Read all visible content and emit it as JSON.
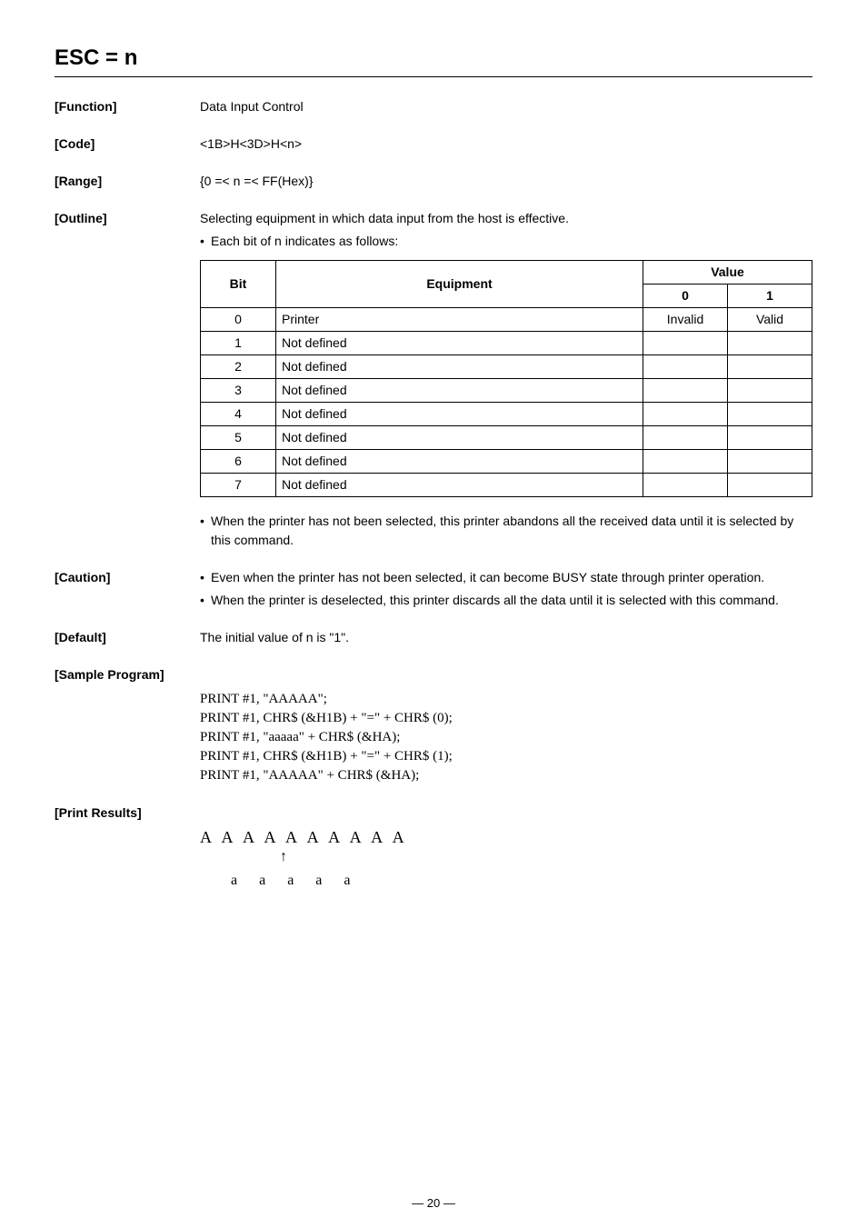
{
  "title": "ESC = n",
  "function": {
    "label": "[Function]",
    "text": "Data Input Control"
  },
  "code": {
    "label": "[Code]",
    "text": "<1B>H<3D>H<n>"
  },
  "range": {
    "label": "[Range]",
    "text": "{0 =< n =< FF(Hex)}"
  },
  "outline": {
    "label": "[Outline]",
    "text": "Selecting equipment in which data input from the host is effective.",
    "bullet": "Each bit of n indicates as follows:"
  },
  "table": {
    "h_bit": "Bit",
    "h_equipment": "Equipment",
    "h_value": "Value",
    "h_0": "0",
    "h_1": "1",
    "rows": [
      {
        "bit": "0",
        "eq": "Printer",
        "v0": "Invalid",
        "v1": "Valid"
      },
      {
        "bit": "1",
        "eq": "Not defined",
        "v0": "",
        "v1": ""
      },
      {
        "bit": "2",
        "eq": "Not defined",
        "v0": "",
        "v1": ""
      },
      {
        "bit": "3",
        "eq": "Not defined",
        "v0": "",
        "v1": ""
      },
      {
        "bit": "4",
        "eq": "Not defined",
        "v0": "",
        "v1": ""
      },
      {
        "bit": "5",
        "eq": "Not defined",
        "v0": "",
        "v1": ""
      },
      {
        "bit": "6",
        "eq": "Not defined",
        "v0": "",
        "v1": ""
      },
      {
        "bit": "7",
        "eq": "Not defined",
        "v0": "",
        "v1": ""
      }
    ]
  },
  "post_table_bullet": "When the printer has not been selected, this printer abandons all the received data until it is selected by this command.",
  "caution": {
    "label": "[Caution]",
    "b1": "Even when the printer has not been selected, it can become BUSY state through printer operation.",
    "b2": "When the printer is deselected, this printer discards all the data until it is selected with this command."
  },
  "default": {
    "label": "[Default]",
    "text": "The initial value of n is \"1\"."
  },
  "sample": {
    "label": "[Sample Program]",
    "l1": "PRINT #1, \"AAAAA\";",
    "l2": "PRINT #1, CHR$ (&H1B) + \"=\" + CHR$ (0);",
    "l3": "PRINT #1, \"aaaaa\" + CHR$ (&HA);",
    "l4": "PRINT #1, CHR$ (&H1B) + \"=\" + CHR$ (1);",
    "l5": "PRINT #1, \"AAAAA\" + CHR$ (&HA);"
  },
  "results": {
    "label": "[Print Results]",
    "line_A": "A A A A A A A A A A",
    "line_a": "a  a  a  a  a"
  },
  "page": "— 20 —"
}
